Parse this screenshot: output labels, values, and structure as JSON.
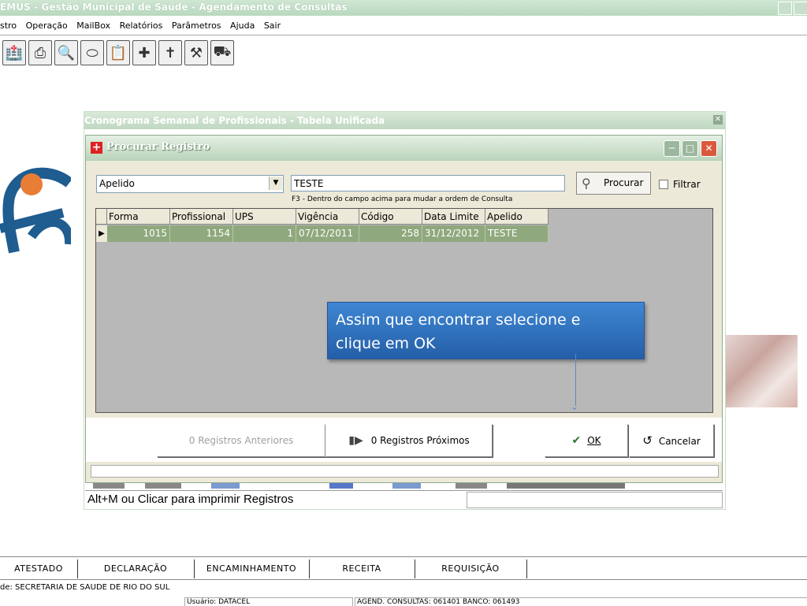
{
  "app": {
    "title": "EMUS - Gestão Municipal de Saúde - Agendamento de Consultas"
  },
  "menu": [
    "stro",
    "Operação",
    "MailBox",
    "Relatórios",
    "Parâmetros",
    "Ajuda",
    "Sair"
  ],
  "toolbar_icons": [
    "hospital-icon",
    "printer-icon",
    "search-doc-icon",
    "pill-icon",
    "clipboard-icon",
    "syringe-icon",
    "cross-icon",
    "medkit-icon",
    "ambulance-icon"
  ],
  "child_window": {
    "title": "Cronograma Semanal de Profissionais - Tabela Unificada",
    "status_text": "Alt+M ou Clicar para imprimir Registros"
  },
  "dialog": {
    "title": "Procurar Registro",
    "order_select": "Apelido",
    "search_value": "TESTE",
    "hint": "F3 - Dentro do campo acima para mudar a ordem de Consulta",
    "search_button": "Procurar",
    "filter_label": "Filtrar",
    "columns": [
      "Forma",
      "Profissional",
      "UPS",
      "Vigência",
      "Código",
      "Data Limite",
      "Apelido"
    ],
    "rows": [
      [
        "1015",
        "1154",
        "1",
        "07/12/2011",
        "258",
        "31/12/2012",
        "TESTE"
      ]
    ],
    "prev_button": "0 Registros Anteriores",
    "next_button": "0 Registros Próximos",
    "ok_button": "OK",
    "cancel_button": "Cancelar"
  },
  "callout": {
    "line1": "Assim que encontrar  selecione e",
    "line2": "clique em OK"
  },
  "bottom_tabs": [
    "ATESTADO",
    "DECLARAÇÃO",
    "ENCAMINHAMENTO",
    "RECEITA",
    "REQUISIÇÃO"
  ],
  "status": {
    "unit": "de: SECRETARIA DE SAUDE DE RIO DO SUL",
    "user": "Usuário: DATACEL",
    "agenda": "AGEND. CONSULTAS: 061401 BANCO: 061493"
  }
}
